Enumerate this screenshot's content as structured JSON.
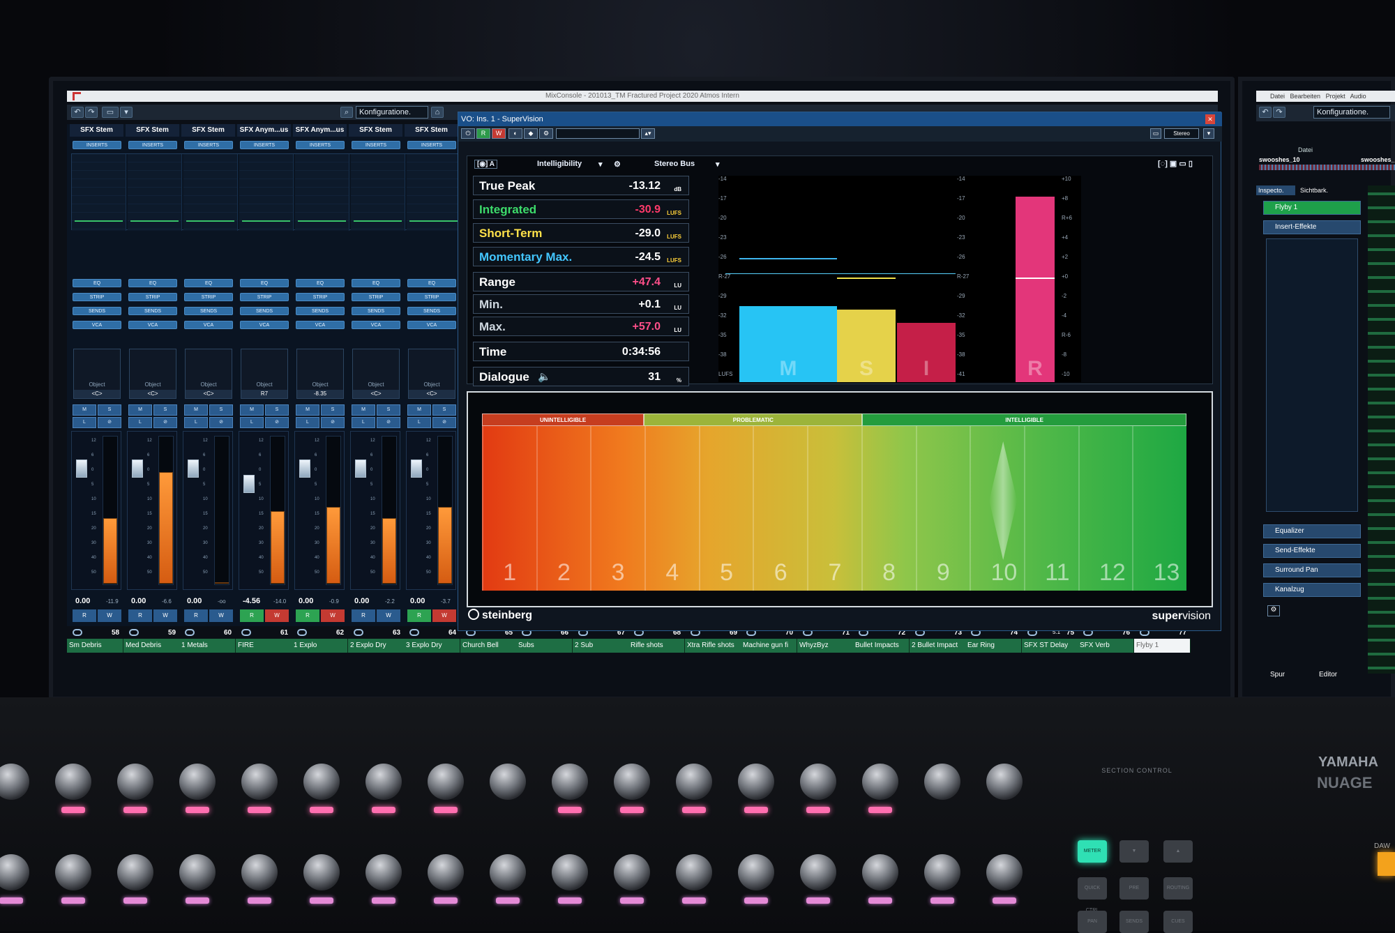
{
  "window": {
    "title": "MixConsole - 201013_TM Fractured Project 2020 Atmos Intern",
    "config_label": "Konfiguratione."
  },
  "mixer": {
    "strip_names": [
      "SFX Stem",
      "SFX Stem",
      "SFX Stem",
      "SFX Anym...us",
      "SFX Anym...us",
      "SFX Stem",
      "SFX Stem"
    ],
    "rack_labels": {
      "inserts": "INSERTS",
      "eq": "EQ",
      "strip": "STRIP",
      "sends": "SENDS",
      "vca": "VCA"
    },
    "panner_label": "Object",
    "panner_values": [
      "<C>",
      "<C>",
      "<C>",
      "R7",
      "-8.35",
      "<C>",
      "<C>"
    ],
    "btn_m": "M",
    "btn_s": "S",
    "btn_l": "L",
    "btn_e": "⊘",
    "gains": [
      "0.00",
      "0.00",
      "0.00",
      "-4.56",
      "0.00",
      "0.00",
      "0.00"
    ],
    "peaks": [
      "-11.9",
      "-6.6",
      "-oo",
      "-14.0",
      "-0.9",
      "-2.2",
      "-3.7"
    ],
    "meter_levels": [
      0.47,
      0.8,
      0.0,
      0.52,
      0.55,
      0.47,
      0.55
    ],
    "scale": [
      "12",
      "6",
      "0",
      "5",
      "10",
      "15",
      "20",
      "30",
      "40",
      "50"
    ],
    "rw": [
      "R",
      "W"
    ]
  },
  "channels": {
    "numbers": [
      "58",
      "59",
      "60",
      "61",
      "62",
      "63",
      "64",
      "65",
      "66",
      "67",
      "68",
      "69",
      "70",
      "71",
      "72",
      "73",
      "74",
      "75",
      "76",
      "77"
    ],
    "names": [
      "Sm Debris",
      "Med Debris",
      "1 Metals",
      "FIRE",
      "1 Explo",
      "2 Explo Dry",
      "3 Explo Dry",
      "Church Bell",
      "Subs",
      "2 Sub",
      "Rifle shots",
      "Xtra Rifle shots",
      "Machine gun fi",
      "WhyzByz",
      "Bullet Impacts",
      "2 Bullet Impact",
      "Ear Ring",
      "SFX ST Delay",
      "SFX Verb",
      "Flyby 1"
    ],
    "extra_label": "5.1"
  },
  "plugin": {
    "title": "VO: Ins. 1 - SuperVision",
    "tool_r": "R",
    "tool_w": "W",
    "stereo_label": "Stereo",
    "module": "Intelligibility",
    "bus": "Stereo Bus",
    "rows": [
      {
        "label": "True Peak",
        "value": "-13.12",
        "unit": "dB",
        "label_color": "#ffffff",
        "value_color": "#ffffff",
        "unit_color": "#ffffff"
      },
      {
        "label": "Integrated",
        "value": "-30.9",
        "unit": "LUFS",
        "label_color": "#3ddc6b",
        "value_color": "#ff3a6a",
        "unit_color": "#ffd23a"
      },
      {
        "label": "Short-Term",
        "value": "-29.0",
        "unit": "LUFS",
        "label_color": "#ffe14a",
        "value_color": "#ffffff",
        "unit_color": "#ffd23a"
      },
      {
        "label": "Momentary Max.",
        "value": "-24.5",
        "unit": "LUFS",
        "label_color": "#43c6ff",
        "value_color": "#ffffff",
        "unit_color": "#ffd23a"
      },
      {
        "label": "Range",
        "value": "+47.4",
        "unit": "LU",
        "label_color": "#ffffff",
        "value_color": "#ff4f8a",
        "unit_color": "#ffffff"
      },
      {
        "label": "Min.",
        "value": "+0.1",
        "unit": "LU",
        "label_color": "#cfd8e0",
        "value_color": "#ffffff",
        "unit_color": "#ffffff"
      },
      {
        "label": "Max.",
        "value": "+57.0",
        "unit": "LU",
        "label_color": "#cfd8e0",
        "value_color": "#ff4f8a",
        "unit_color": "#ffffff"
      },
      {
        "label": "Time",
        "value": "0:34:56",
        "unit": "",
        "label_color": "#ffffff",
        "value_color": "#ffffff",
        "unit_color": "#ffffff"
      },
      {
        "label": "Dialogue",
        "value": "31",
        "unit": "%",
        "label_color": "#ffffff",
        "value_color": "#ffffff",
        "unit_color": "#ffffff"
      }
    ],
    "graph_ticks_left": [
      "-14",
      "-17",
      "-20",
      "-23",
      "-26",
      "R-27",
      "-29",
      "-32",
      "-35",
      "-38",
      "LUFS"
    ],
    "graph_ticks_mid": [
      "-14",
      "-17",
      "-20",
      "-23",
      "-26",
      "R-27",
      "-29",
      "-32",
      "-35",
      "-38",
      "-41"
    ],
    "graph_ticks_right": [
      "+10",
      "+8",
      "R+6",
      "+4",
      "+2",
      "+0",
      "-2",
      "-4",
      "R-6",
      "-8",
      "-10"
    ],
    "bars": [
      {
        "label": "M",
        "level": 0.41,
        "color": "#27c4f4"
      },
      {
        "label": "S",
        "level": 0.39,
        "color": "#e5d24a"
      },
      {
        "label": "I",
        "level": 0.32,
        "color": "#c51f48"
      },
      {
        "label": "R",
        "level": 1.0,
        "color": "#e3367a"
      }
    ],
    "zones": [
      "UNINTELLIGIBLE",
      "PROBLEMATIC",
      "INTELLIGIBLE"
    ],
    "categories": [
      "1",
      "2",
      "3",
      "4",
      "5",
      "6",
      "7",
      "8",
      "9",
      "10",
      "11",
      "12",
      "13"
    ],
    "brand": "steinberg",
    "product_a": "super",
    "product_b": "vision"
  },
  "right_window": {
    "menu": [
      "Datei",
      "Bearbeiten",
      "Projekt",
      "Audio"
    ],
    "config_label": "Konfiguratione.",
    "column_label": "Datei",
    "track_a": "swooshes_10",
    "track_b": "swooshes_",
    "tab_inspector": "Inspecto.",
    "tab_visibility": "Sichtbark.",
    "selected_track": "Flyby 1",
    "sections": [
      "Insert-Effekte",
      "Equalizer",
      "Send-Effekte",
      "Surround Pan",
      "Kanalzug"
    ],
    "tab_spur": "Spur",
    "tab_editor": "Editor"
  },
  "hardware": {
    "section_control": "SECTION CONTROL",
    "meter_btn": "METER",
    "brand": "YAMAHA",
    "model": "NUAGE",
    "btn_quick": "QUICK CTRL",
    "btn_pre": "PRE",
    "btn_routing": "ROUTING",
    "btn_pan": "PAN",
    "btn_sends": "SENDS",
    "btn_cues": "CUES",
    "daw": "DAW"
  }
}
